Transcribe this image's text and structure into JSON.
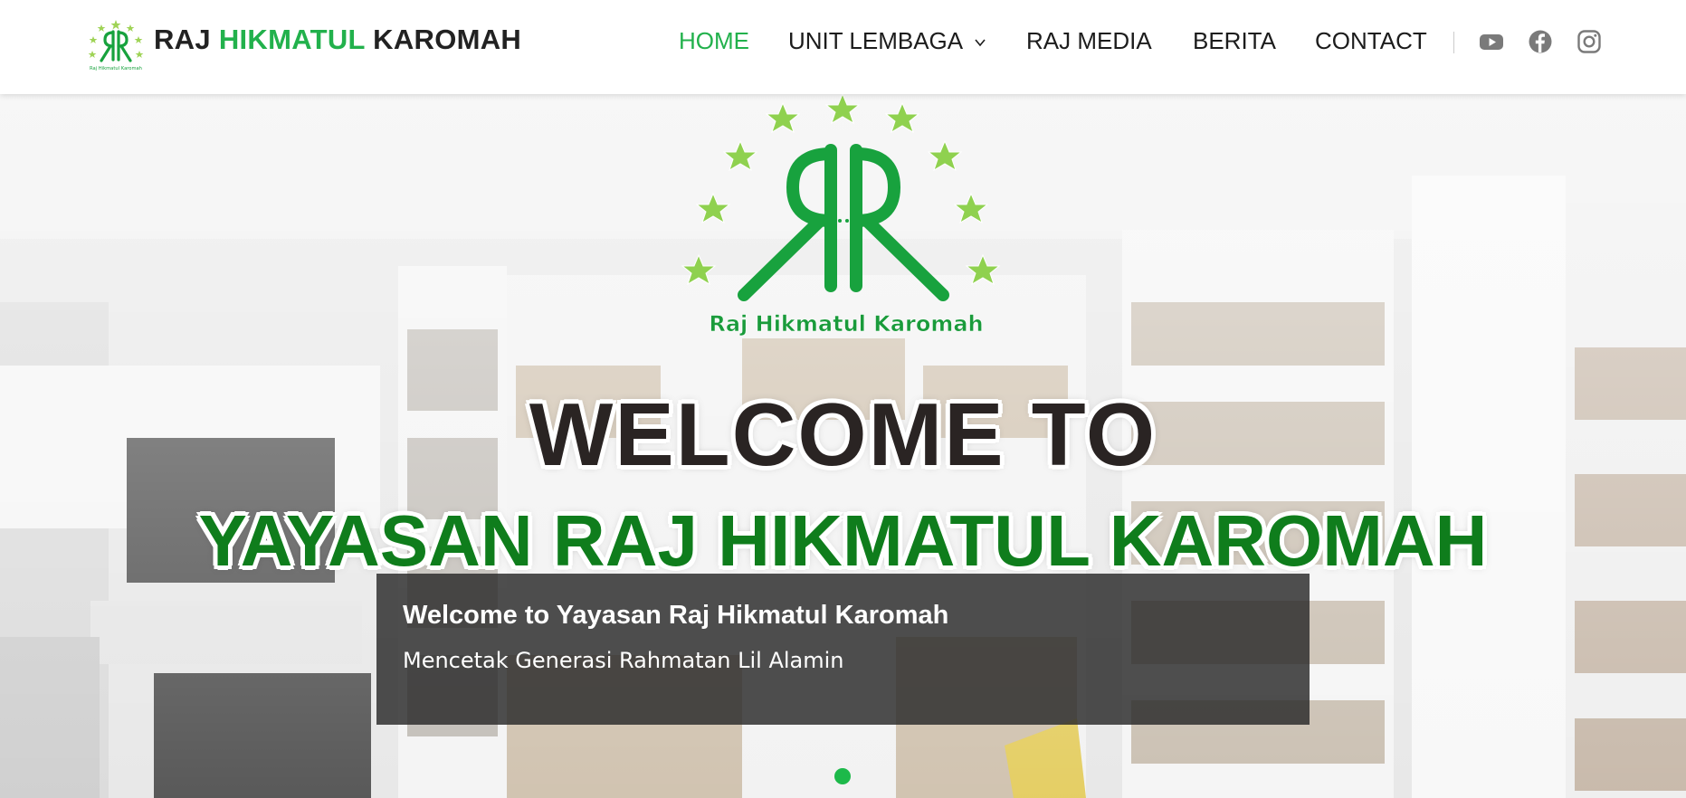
{
  "brand": {
    "part1": "RAJ ",
    "part2": "HIKMATUL",
    "part3": " KAROMAH",
    "logo_icon": "rk-logo-icon",
    "logo_caption": "Raj Hikmatul Karomah"
  },
  "nav": {
    "items": [
      {
        "label": "HOME",
        "active": true
      },
      {
        "label": "UNIT LEMBAGA",
        "has_dropdown": true
      },
      {
        "label": "RAJ MEDIA"
      },
      {
        "label": "BERITA"
      },
      {
        "label": "CONTACT"
      }
    ],
    "social": [
      "youtube-icon",
      "facebook-icon",
      "instagram-icon"
    ]
  },
  "hero": {
    "logo_caption": "Raj Hikmatul Karomah",
    "welcome": "WELCOME TO",
    "org_name": "YAYASAN RAJ HIKMATUL KAROMAH",
    "caption_title": "Welcome to Yayasan Raj Hikmatul Karomah",
    "caption_subtitle": "Mencetak Generasi Rahmatan Lil Alamin",
    "slides_count": 1,
    "active_slide": 1
  },
  "colors": {
    "accent": "#22b14c",
    "nav_text": "#1c1c1c",
    "org_text": "#0f7d1c",
    "caption_bg": "#282828",
    "star": "#8fd14f"
  }
}
